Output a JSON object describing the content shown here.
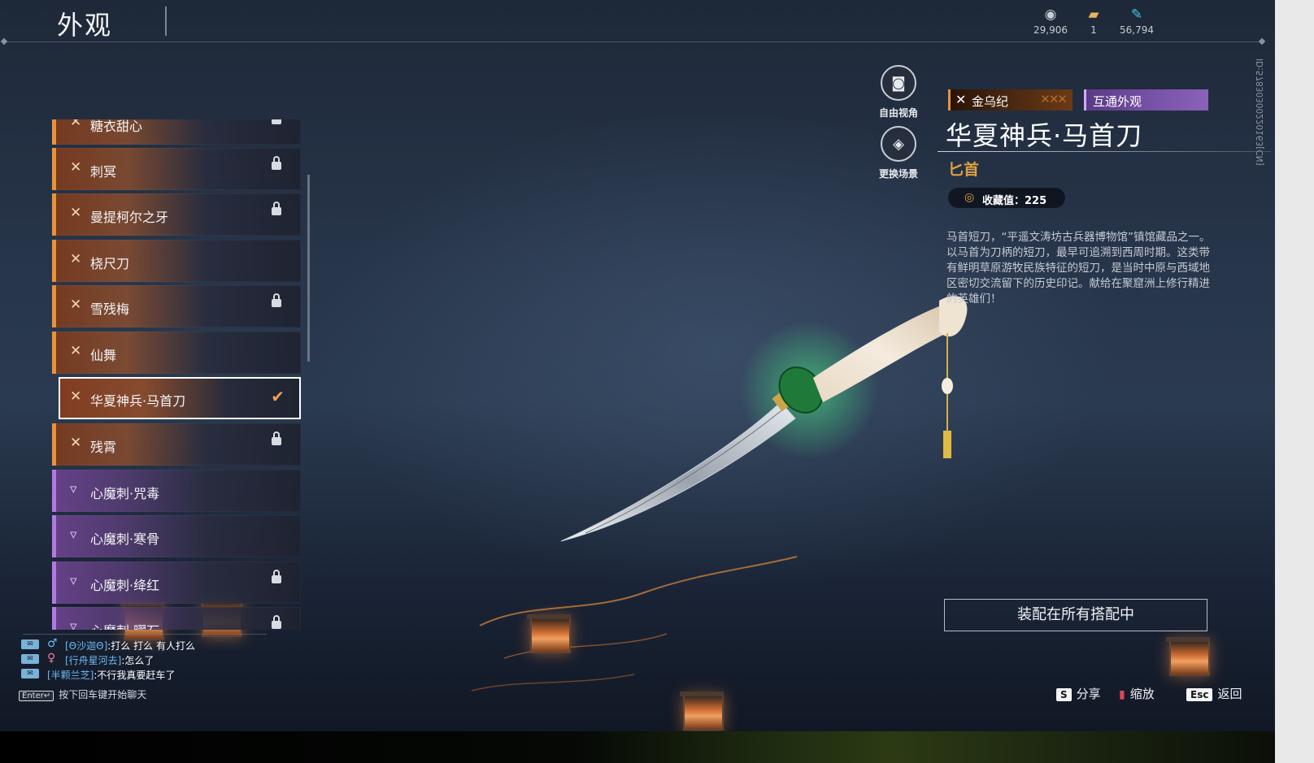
{
  "topbar": {
    "title": "外观",
    "currencies": [
      {
        "icon": "silver-coin-icon",
        "value": "29,906"
      },
      {
        "icon": "ticket-icon",
        "value": "1"
      },
      {
        "icon": "feather-icon",
        "value": "56,794"
      }
    ]
  },
  "list": {
    "items": [
      {
        "label": "糖衣甜心",
        "icon": "gold-rarity-icon",
        "locked": true,
        "rarity": "gold"
      },
      {
        "label": "刺冥",
        "icon": "gold-rarity-icon",
        "locked": true,
        "rarity": "gold"
      },
      {
        "label": "曼提柯尔之牙",
        "icon": "gold-rarity-icon",
        "locked": true,
        "rarity": "gold"
      },
      {
        "label": "桡尺刀",
        "icon": "gold-rarity-icon",
        "locked": false,
        "rarity": "gold"
      },
      {
        "label": "雪残梅",
        "icon": "gold-rarity-icon",
        "locked": true,
        "rarity": "gold"
      },
      {
        "label": "仙舞",
        "icon": "gold-rarity-icon",
        "locked": false,
        "rarity": "gold"
      },
      {
        "label": "华夏神兵·马首刀",
        "icon": "gold-rarity-icon",
        "locked": false,
        "rarity": "gold",
        "selected": true
      },
      {
        "label": "残霄",
        "icon": "gold-rarity-icon",
        "locked": true,
        "rarity": "gold"
      },
      {
        "label": "心魔刺·咒毒",
        "icon": "purple-rarity-icon",
        "locked": false,
        "rarity": "purple"
      },
      {
        "label": "心魔刺·寒骨",
        "icon": "purple-rarity-icon",
        "locked": false,
        "rarity": "purple"
      },
      {
        "label": "心魔刺·绛红",
        "icon": "purple-rarity-icon",
        "locked": true,
        "rarity": "purple"
      },
      {
        "label": "心魔刺·曜石",
        "icon": "purple-rarity-icon",
        "locked": true,
        "rarity": "purple"
      }
    ]
  },
  "side_buttons": {
    "free_view": "自由视角",
    "change_scene": "更换场景"
  },
  "detail": {
    "tag_series": "金乌纪",
    "tag_shared": "互通外观",
    "name": "华夏神兵·马首刀",
    "type": "匕首",
    "collection": "收藏值：225",
    "description": "马首短刀，“平遥文涛坊古兵器博物馆”镇馆藏品之一。以马首为刀柄的短刀，最早可追溯到西周时期。这类带有鲜明草原游牧民族特征的短刀，是当时中原与西域地区密切交流留下的历史印记。献给在聚窟洲上修行精进的英雄们！",
    "id_text": "ID:57830300220163[CN]",
    "equip_button": "装配在所有搭配中"
  },
  "chat": {
    "lines": [
      {
        "gender": "male",
        "name": "[Θ沙迦Θ]",
        "message": ":打么 打么 有人打么"
      },
      {
        "gender": "female",
        "name": "[行舟星河去]",
        "message": ":怎么了"
      },
      {
        "gender": "male",
        "name": "[半颗兰芝]",
        "message": ":不行我真要赶车了"
      }
    ],
    "enter_key": "Enter↵",
    "enter_hint": "按下回车键开始聊天"
  },
  "hints": {
    "share_key": "S",
    "share": "分享",
    "zoom": "缩放",
    "back_key": "Esc",
    "back": "返回"
  },
  "colors": {
    "gold_accent": "#e8923a",
    "purple_accent": "#b07ae0",
    "type_text": "#e0a044"
  }
}
